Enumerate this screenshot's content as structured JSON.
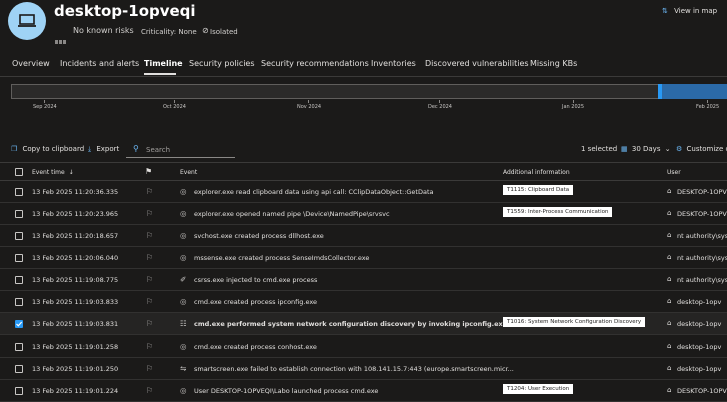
{
  "header": {
    "device_name": "desktop-1opveqi",
    "risk_label": "No known risks",
    "criticality": "Criticality: None",
    "status": "Isolated",
    "view_in_map": "View in map"
  },
  "tabs": [
    {
      "label": "Overview"
    },
    {
      "label": "Incidents and alerts"
    },
    {
      "label": "Timeline"
    },
    {
      "label": "Security policies"
    },
    {
      "label": "Security recommendations"
    },
    {
      "label": "Inventories"
    },
    {
      "label": "Discovered vulnerabilities"
    },
    {
      "label": "Missing KBs"
    }
  ],
  "timeline": {
    "months": [
      "Sep 2024",
      "Oct 2024",
      "Nov 2024",
      "Dec 2024",
      "Jan 2025",
      "Feb 2025"
    ]
  },
  "toolbar": {
    "copy": "Copy to clipboard",
    "export": "Export",
    "search_placeholder": "Search",
    "selected_count": "1 selected",
    "range": "30 Days",
    "customize": "Customize c"
  },
  "table": {
    "columns": [
      "Event time",
      "Event",
      "Additional information",
      "User"
    ],
    "rows": [
      {
        "time": "13 Feb 2025 11:20:36.335",
        "event": "explorer.exe read clipboard data using api call: CClipDataObject::GetData",
        "info": "T1115: Clipboard Data",
        "user": "DESKTOP-1OPV",
        "icon": "globe-icon",
        "checked": false
      },
      {
        "time": "13 Feb 2025 11:20:23.965",
        "event": "explorer.exe opened named pipe \\Device\\NamedPipe\\srvsvc",
        "info": "T1559: Inter-Process Communication",
        "user": "DESKTOP-1OPV",
        "icon": "globe-icon",
        "checked": false
      },
      {
        "time": "13 Feb 2025 11:20:18.657",
        "event": "svchost.exe created process dllhost.exe",
        "info": "",
        "user": "nt authority\\sys",
        "icon": "globe-icon",
        "checked": false
      },
      {
        "time": "13 Feb 2025 11:20:06.040",
        "event": "mssense.exe created process SenseImdsCollector.exe",
        "info": "",
        "user": "nt authority\\sys",
        "icon": "globe-icon",
        "checked": false
      },
      {
        "time": "13 Feb 2025 11:19:08.775",
        "event": "csrss.exe injected to cmd.exe process",
        "info": "",
        "user": "nt authority\\sys",
        "icon": "syringe-icon",
        "checked": false
      },
      {
        "time": "13 Feb 2025 11:19:03.833",
        "event": "cmd.exe created process ipconfig.exe",
        "info": "",
        "user": "desktop-1opv",
        "icon": "globe-icon",
        "checked": false
      },
      {
        "time": "13 Feb 2025 11:19:03.831",
        "event": "cmd.exe performed system network configuration discovery by invoking ipconfig.exe",
        "info": "T1016: System Network Configuration Discovery",
        "user": "desktop-1opv",
        "icon": "terminal-icon",
        "checked": true
      },
      {
        "time": "13 Feb 2025 11:19:01.258",
        "event": "cmd.exe created process conhost.exe",
        "info": "",
        "user": "desktop-1opv",
        "icon": "globe-icon",
        "checked": false
      },
      {
        "time": "13 Feb 2025 11:19:01.250",
        "event": "smartscreen.exe failed to establish connection with 108.141.15.7:443 (europe.smartscreen.micr...",
        "info": "",
        "user": "desktop-1opv",
        "icon": "connection-icon",
        "checked": false
      },
      {
        "time": "13 Feb 2025 11:19:01.224",
        "event": "User DESKTOP-1OPVEQI\\Labo launched process cmd.exe",
        "info": "T1204: User Execution",
        "user": "DESKTOP-1OPV",
        "icon": "globe-icon",
        "checked": false
      }
    ]
  }
}
